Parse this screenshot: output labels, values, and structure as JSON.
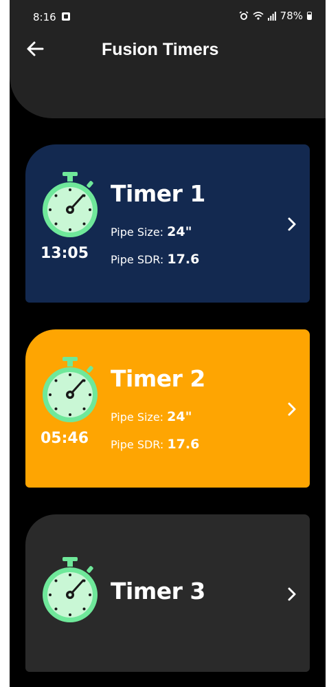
{
  "status_bar": {
    "time": "8:16",
    "battery": "78%",
    "icons": [
      "alarm-icon",
      "wifi-icon",
      "signal-icon",
      "battery-icon"
    ]
  },
  "header": {
    "title": "Fusion Timers",
    "back_icon": "arrow-left-icon"
  },
  "timers": [
    {
      "name": "Timer 1",
      "time": "13:05",
      "pipe_size_label": "Pipe Size:",
      "pipe_size_value": "24\"",
      "pipe_sdr_label": "Pipe SDR:",
      "pipe_sdr_value": "17.6",
      "color": "#132950"
    },
    {
      "name": "Timer 2",
      "time": "05:46",
      "pipe_size_label": "Pipe Size:",
      "pipe_size_value": "24\"",
      "pipe_sdr_label": "Pipe SDR:",
      "pipe_sdr_value": "17.6",
      "color": "#fea502"
    },
    {
      "name": "Timer 3",
      "color": "#2a2a2a"
    }
  ],
  "colors": {
    "background": "#000000",
    "top_bar": "#232323",
    "stopwatch_face": "#c9f7d5",
    "stopwatch_rim": "#5ee08c"
  }
}
